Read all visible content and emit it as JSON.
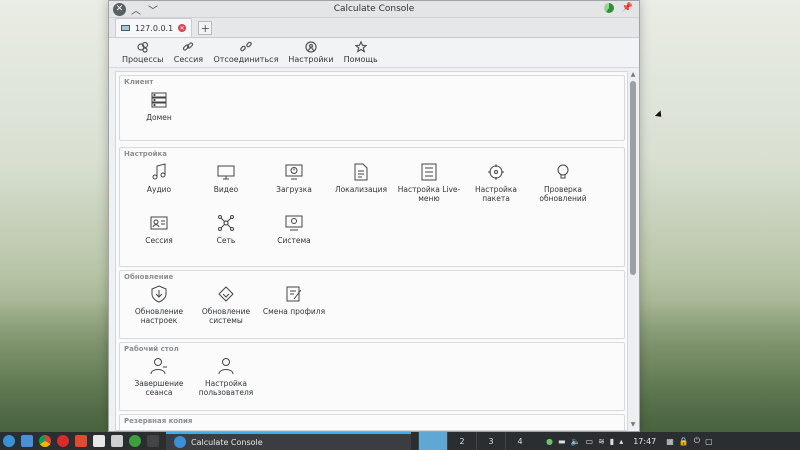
{
  "window": {
    "title": "Calculate Console"
  },
  "tab": {
    "label": "127.0.0.1",
    "add": "+"
  },
  "toolbar": [
    {
      "label": "Процессы",
      "icon": "processes-icon"
    },
    {
      "label": "Сессия",
      "icon": "link-icon"
    },
    {
      "label": "Отсоединиться",
      "icon": "broken-link-icon"
    },
    {
      "label": "Настройки",
      "icon": "settings-icon"
    },
    {
      "label": "Помощь",
      "icon": "star-icon"
    }
  ],
  "groups": [
    {
      "title": "Клиент",
      "items": [
        {
          "label": "Домен",
          "icon": "server-icon"
        }
      ]
    },
    {
      "title": "Настройка",
      "items": [
        {
          "label": "Аудио",
          "icon": "music-note-icon"
        },
        {
          "label": "Видео",
          "icon": "monitor-icon"
        },
        {
          "label": "Загрузка",
          "icon": "boot-icon"
        },
        {
          "label": "Локализация",
          "icon": "locale-document-icon"
        },
        {
          "label": "Настройка Live-меню",
          "icon": "list-icon"
        },
        {
          "label": "Настройка пакета",
          "icon": "package-icon"
        },
        {
          "label": "Проверка обновлений",
          "icon": "bulb-icon"
        },
        {
          "label": "Сессия",
          "icon": "id-card-icon"
        },
        {
          "label": "Сеть",
          "icon": "network-icon"
        },
        {
          "label": "Система",
          "icon": "system-icon"
        }
      ]
    },
    {
      "title": "Обновление",
      "items": [
        {
          "label": "Обновление настроек",
          "icon": "shield-update-icon"
        },
        {
          "label": "Обновление системы",
          "icon": "system-update-icon"
        },
        {
          "label": "Смена профиля",
          "icon": "profile-edit-icon"
        }
      ]
    },
    {
      "title": "Рабочий стол",
      "items": [
        {
          "label": "Завершение сеанса",
          "icon": "user-logout-icon"
        },
        {
          "label": "Настройка пользователя",
          "icon": "user-icon"
        }
      ]
    },
    {
      "title": "Резервная копия",
      "items": []
    }
  ],
  "taskbar": {
    "task_label": "Calculate Console",
    "desktops": [
      "2",
      "3",
      "4"
    ],
    "clock": "17:47"
  }
}
